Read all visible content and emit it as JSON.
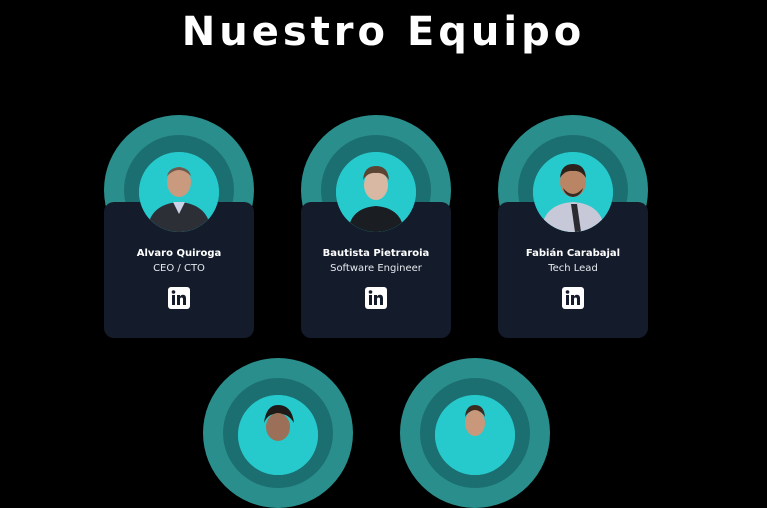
{
  "page": {
    "title": "Nuestro Equipo"
  },
  "team": [
    {
      "name": "Alvaro Quiroga",
      "role": "CEO / CTO",
      "linkedin_icon": "linkedin-icon"
    },
    {
      "name": "Bautista Pietraroia",
      "role": "Software Engineer",
      "linkedin_icon": "linkedin-icon"
    },
    {
      "name": "Fabián Carabajal",
      "role": "Tech Lead",
      "linkedin_icon": "linkedin-icon"
    },
    {
      "name": "",
      "role": "",
      "linkedin_icon": "linkedin-icon"
    },
    {
      "name": "",
      "role": "",
      "linkedin_icon": "linkedin-icon"
    }
  ],
  "colors": {
    "background": "#000000",
    "arc_outer": "#2a8f8c",
    "arc_inner": "#1c6f70",
    "photo_bg": "#26c9cc",
    "card": "#141c2b"
  }
}
